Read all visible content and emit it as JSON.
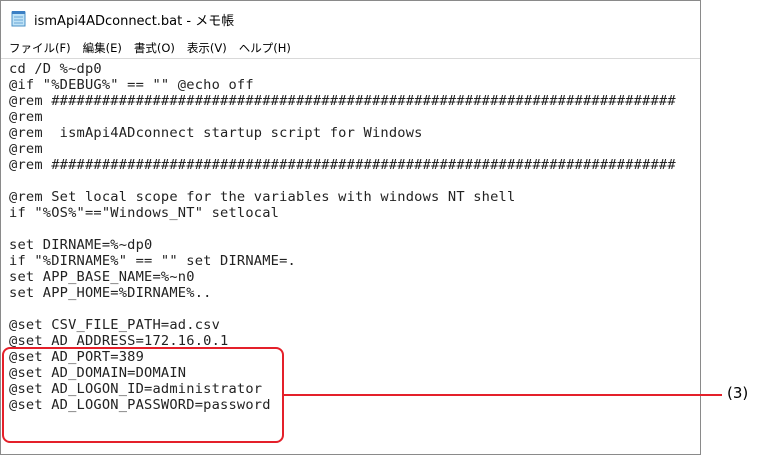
{
  "window": {
    "title": "ismApi4ADconnect.bat - メモ帳",
    "app_icon": "notepad-icon"
  },
  "menubar": {
    "items": [
      {
        "label": "ファイル(F)"
      },
      {
        "label": "編集(E)"
      },
      {
        "label": "書式(O)"
      },
      {
        "label": "表示(V)"
      },
      {
        "label": "ヘルプ(H)"
      }
    ]
  },
  "editor": {
    "lines": [
      "cd /D %~dp0",
      "@if \"%DEBUG%\" == \"\" @echo off",
      "@rem ##########################################################################",
      "@rem",
      "@rem  ismApi4ADconnect startup script for Windows",
      "@rem",
      "@rem ##########################################################################",
      "",
      "@rem Set local scope for the variables with windows NT shell",
      "if \"%OS%\"==\"Windows_NT\" setlocal",
      "",
      "set DIRNAME=%~dp0",
      "if \"%DIRNAME%\" == \"\" set DIRNAME=.",
      "set APP_BASE_NAME=%~n0",
      "set APP_HOME=%DIRNAME%..",
      "",
      "@set CSV_FILE_PATH=ad.csv",
      "@set AD_ADDRESS=172.16.0.1",
      "@set AD_PORT=389",
      "@set AD_DOMAIN=DOMAIN",
      "@set AD_LOGON_ID=administrator",
      "@set AD_LOGON_PASSWORD=password"
    ]
  },
  "annotation": {
    "label": "(3)",
    "color": "#e4202a"
  }
}
